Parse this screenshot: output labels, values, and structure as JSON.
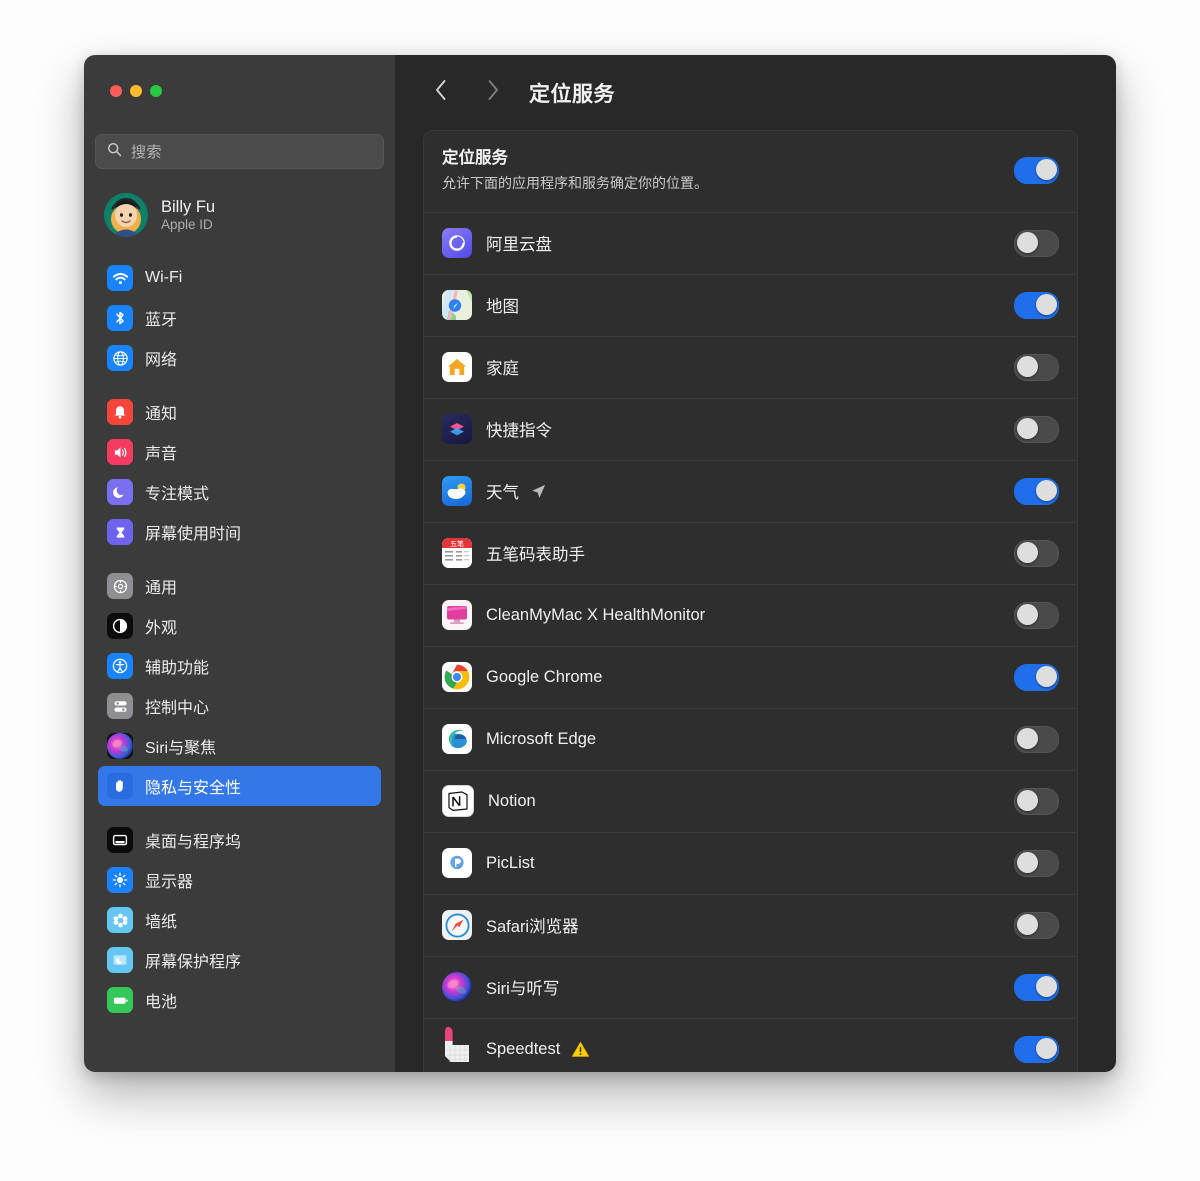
{
  "window": {
    "traffic_lights": [
      "close",
      "minimize",
      "zoom"
    ],
    "colors": {
      "accent_blue": "#1f6feb",
      "selection_blue": "#3477e8",
      "highlight_box": "#5bb8ee",
      "sidebar_bg": "#3b3b3b",
      "main_bg": "#282828",
      "card_bg": "#2e2e2e",
      "warning_yellow": "#ffcc00"
    }
  },
  "sidebar": {
    "search": {
      "placeholder": "搜索",
      "value": "",
      "icon": "search-icon"
    },
    "account": {
      "name": "Billy Fu",
      "subtitle": "Apple ID",
      "avatar": "memoji-avatar"
    },
    "groups": [
      {
        "items": [
          {
            "label": "Wi-Fi",
            "icon": "wifi-icon"
          },
          {
            "label": "蓝牙",
            "icon": "bluetooth-icon"
          },
          {
            "label": "网络",
            "icon": "globe-icon"
          }
        ]
      },
      {
        "items": [
          {
            "label": "通知",
            "icon": "bell-icon"
          },
          {
            "label": "声音",
            "icon": "speaker-icon"
          },
          {
            "label": "专注模式",
            "icon": "moon-icon"
          },
          {
            "label": "屏幕使用时间",
            "icon": "hourglass-icon"
          }
        ]
      },
      {
        "items": [
          {
            "label": "通用",
            "icon": "gear-icon"
          },
          {
            "label": "外观",
            "icon": "appearance-icon"
          },
          {
            "label": "辅助功能",
            "icon": "accessibility-icon"
          },
          {
            "label": "控制中心",
            "icon": "control-center-icon"
          },
          {
            "label": "Siri与聚焦",
            "icon": "siri-icon"
          },
          {
            "label": "隐私与安全性",
            "icon": "hand-icon",
            "selected": true
          }
        ]
      },
      {
        "items": [
          {
            "label": "桌面与程序坞",
            "icon": "desktop-dock-icon"
          },
          {
            "label": "显示器",
            "icon": "display-icon"
          },
          {
            "label": "墙纸",
            "icon": "wallpaper-icon"
          },
          {
            "label": "屏幕保护程序",
            "icon": "screensaver-icon"
          },
          {
            "label": "电池",
            "icon": "battery-icon"
          }
        ]
      }
    ]
  },
  "main": {
    "nav": {
      "back": "‹",
      "forward": "›",
      "back_icon": "chevron-left-icon",
      "forward_icon": "chevron-right-icon"
    },
    "title": "定位服务",
    "master": {
      "title": "定位服务",
      "description": "允许下面的应用程序和服务确定你的位置。",
      "toggle_state": "on",
      "highlighted": true
    },
    "apps": [
      {
        "name": "阿里云盘",
        "icon": "aliyun-drive-icon",
        "toggle_state": "off",
        "badge": ""
      },
      {
        "name": "地图",
        "icon": "maps-icon",
        "toggle_state": "on",
        "badge": ""
      },
      {
        "name": "家庭",
        "icon": "home-icon",
        "toggle_state": "off",
        "badge": ""
      },
      {
        "name": "快捷指令",
        "icon": "shortcuts-icon",
        "toggle_state": "off",
        "badge": ""
      },
      {
        "name": "天气",
        "icon": "weather-icon",
        "toggle_state": "on",
        "badge": "location-arrow-icon"
      },
      {
        "name": "五笔码表助手",
        "icon": "wubi-icon",
        "toggle_state": "off",
        "badge": ""
      },
      {
        "name": "CleanMyMac X HealthMonitor",
        "icon": "cleanmymac-icon",
        "toggle_state": "off",
        "badge": ""
      },
      {
        "name": "Google Chrome",
        "icon": "chrome-icon",
        "toggle_state": "on",
        "badge": ""
      },
      {
        "name": "Microsoft Edge",
        "icon": "edge-icon",
        "toggle_state": "off",
        "badge": ""
      },
      {
        "name": "Notion",
        "icon": "notion-icon",
        "toggle_state": "off",
        "badge": ""
      },
      {
        "name": "PicList",
        "icon": "piclist-icon",
        "toggle_state": "off",
        "badge": ""
      },
      {
        "name": "Safari浏览器",
        "icon": "safari-icon",
        "toggle_state": "off",
        "badge": ""
      },
      {
        "name": "Siri与听写",
        "icon": "siri-icon",
        "toggle_state": "on",
        "badge": ""
      },
      {
        "name": "Speedtest",
        "icon": "speedtest-icon",
        "toggle_state": "on",
        "badge": "warning-triangle-icon"
      }
    ]
  }
}
